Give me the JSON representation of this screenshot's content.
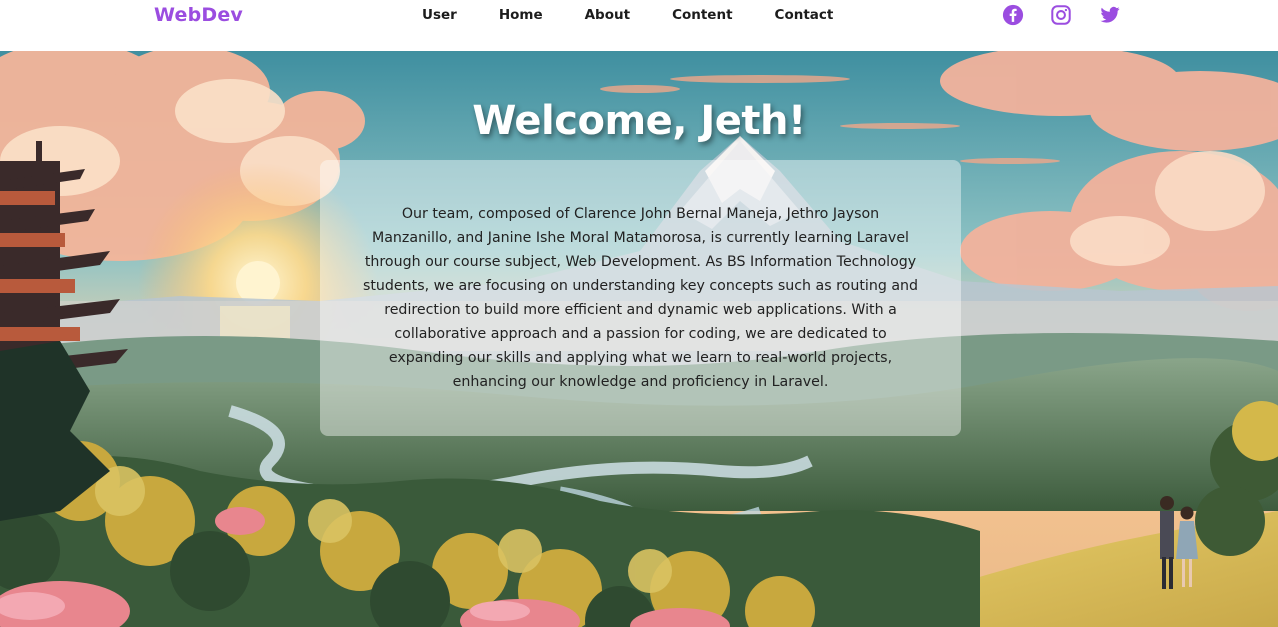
{
  "navbar": {
    "brand": "WebDev",
    "links": [
      "User",
      "Home",
      "About",
      "Content",
      "Contact"
    ],
    "social": [
      {
        "name": "facebook-icon",
        "color": "#9b4de0"
      },
      {
        "name": "instagram-icon",
        "color": "#9b4de0"
      },
      {
        "name": "twitter-icon",
        "color": "#9b4de0"
      }
    ]
  },
  "hero": {
    "heading": "Welcome, Jeth!",
    "description": "Our team, composed of Clarence John Bernal Maneja, Jethro Jayson Manzanillo, and Janine Ishe Moral Matamorosa, is currently learning Laravel through our course subject, Web Development. As BS Information Technology students, we are focusing on understanding key concepts such as routing and redirection to build more efficient and dynamic web applications. With a collaborative approach and a passion for coding, we are dedicated to expanding our skills and applying what we learn to real-world projects, enhancing our knowledge and proficiency in Laravel."
  },
  "colors": {
    "accent": "#9b4de0",
    "nav_text": "#1c1c1c",
    "card_bg": "rgba(255,255,255,0.42)"
  }
}
